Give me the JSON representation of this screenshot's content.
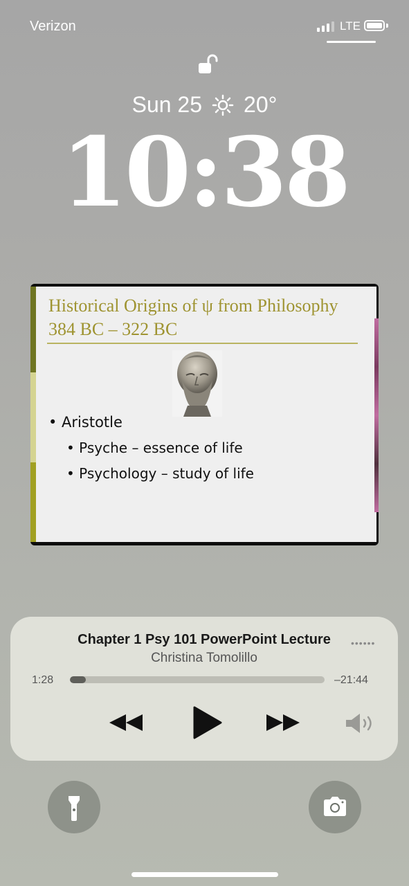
{
  "status_bar": {
    "carrier": "Verizon",
    "network": "LTE",
    "signal_icon": "cellular-signal-icon",
    "battery_icon": "battery-icon"
  },
  "lock_screen": {
    "lock_icon": "unlocked-padlock-icon",
    "date": "Sun 25",
    "weather_icon": "sun-icon",
    "temperature": "20°",
    "time": "10:38"
  },
  "media_artwork": {
    "slide_title_line1": "Historical Origins of ψ from Philosophy",
    "slide_title_line2": "384 BC – 322 BC",
    "bullets": [
      "• Aristotle",
      "• Psyche – essence of life",
      "• Psychology – study of life"
    ]
  },
  "now_playing": {
    "title": "Chapter 1 Psy 101 PowerPoint Lecture",
    "artist": "Christina Tomolillo",
    "elapsed": "1:28",
    "remaining": "–21:44",
    "progress": 0.063
  },
  "quick_actions": {
    "flashlight_icon": "flashlight-icon",
    "camera_icon": "camera-icon"
  }
}
